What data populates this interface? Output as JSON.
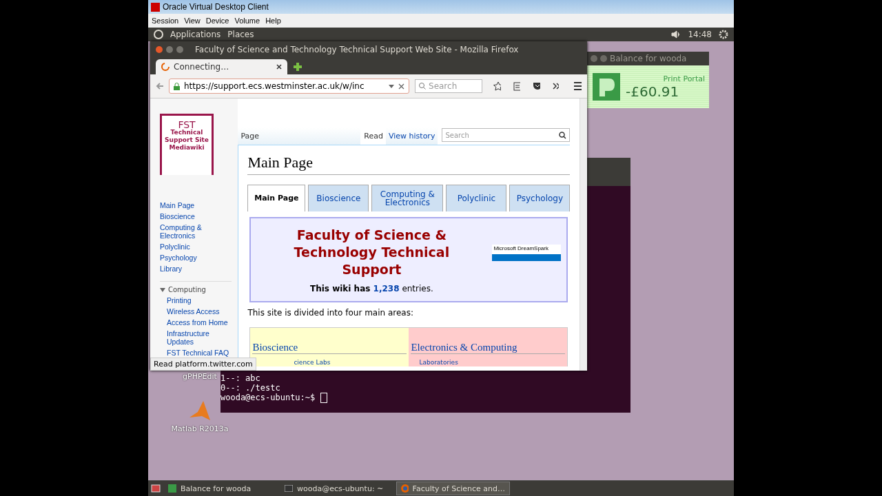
{
  "client_window": {
    "title": "Oracle Virtual Desktop Client",
    "menu": [
      "Session",
      "View",
      "Device",
      "Volume",
      "Help"
    ]
  },
  "top_panel": {
    "menus": [
      "Applications",
      "Places"
    ],
    "clock": "14:48"
  },
  "desktop_icons": [
    {
      "label": "gPHPEdit",
      "kind": "php"
    },
    {
      "label": "Matlab R2013a",
      "kind": "matlab"
    }
  ],
  "terminal": {
    "lines": [
      "1--: abc",
      "0--: ./testc"
    ],
    "prompt": "wooda@ecs-ubuntu:~$"
  },
  "balance_widget": {
    "title": "Balance for wooda",
    "portal": "Print Portal",
    "amount": "-£60.91"
  },
  "firefox": {
    "title": "Faculty of Science and Technology Technical Support Web Site - Mozilla Firefox",
    "tabs": [
      {
        "label": "Connecting…",
        "selected": true,
        "loading": true
      }
    ],
    "url": "https://support.ecs.westminster.ac.uk/w/inc",
    "search_placeholder": "Search",
    "status": "Read platform.twitter.com",
    "page": {
      "logo": {
        "title": "FST",
        "lines": [
          "Technical",
          "Support Site",
          "Mediawiki"
        ]
      },
      "sidebar": [
        {
          "label": "Main Page"
        },
        {
          "label": "Bioscience"
        },
        {
          "label": "Computing & Electronics"
        },
        {
          "label": "Polyclinic"
        },
        {
          "label": "Psychology"
        },
        {
          "label": "Library"
        }
      ],
      "sidebar_section": {
        "label": "Computing",
        "expanded": true,
        "children": [
          {
            "label": "Printing"
          },
          {
            "label": "Wireless Access"
          },
          {
            "label": "Access from Home"
          },
          {
            "label": "Infrastructure Updates"
          },
          {
            "label": "FST Technical FAQ"
          }
        ]
      },
      "page_tab": "Page",
      "view_tabs": [
        {
          "label": "Read",
          "selected": true
        },
        {
          "label": "View history",
          "selected": false
        }
      ],
      "wiki_search_placeholder": "Search",
      "heading": "Main Page",
      "content_tabs": [
        {
          "label": "Main Page",
          "selected": true
        },
        {
          "label": "Bioscience",
          "selected": false
        },
        {
          "label": "Computing & Electronics",
          "selected": false
        },
        {
          "label": "Polyclinic",
          "selected": false
        },
        {
          "label": "Psychology",
          "selected": false
        }
      ],
      "banner": {
        "title": "Faculty of Science & Technology Technical Support",
        "count_before": "This wiki has",
        "count": "1,238",
        "count_after": "entries.",
        "badge": "Microsoft DreamSpark"
      },
      "intro": "This site is divided into four main areas:",
      "areas": [
        {
          "title": "Bioscience",
          "link": "cience Labs",
          "color": "#ffffcc"
        },
        {
          "title": "Electronics & Computing",
          "link": "Laboratories",
          "color": "#ffcccc"
        }
      ]
    }
  },
  "taskbar": [
    {
      "label": "Balance for wooda",
      "kind": "portal",
      "selected": false
    },
    {
      "label": "wooda@ecs-ubuntu: ~",
      "kind": "terminal",
      "selected": false
    },
    {
      "label": "Faculty of Science and…",
      "kind": "firefox",
      "selected": true
    }
  ]
}
